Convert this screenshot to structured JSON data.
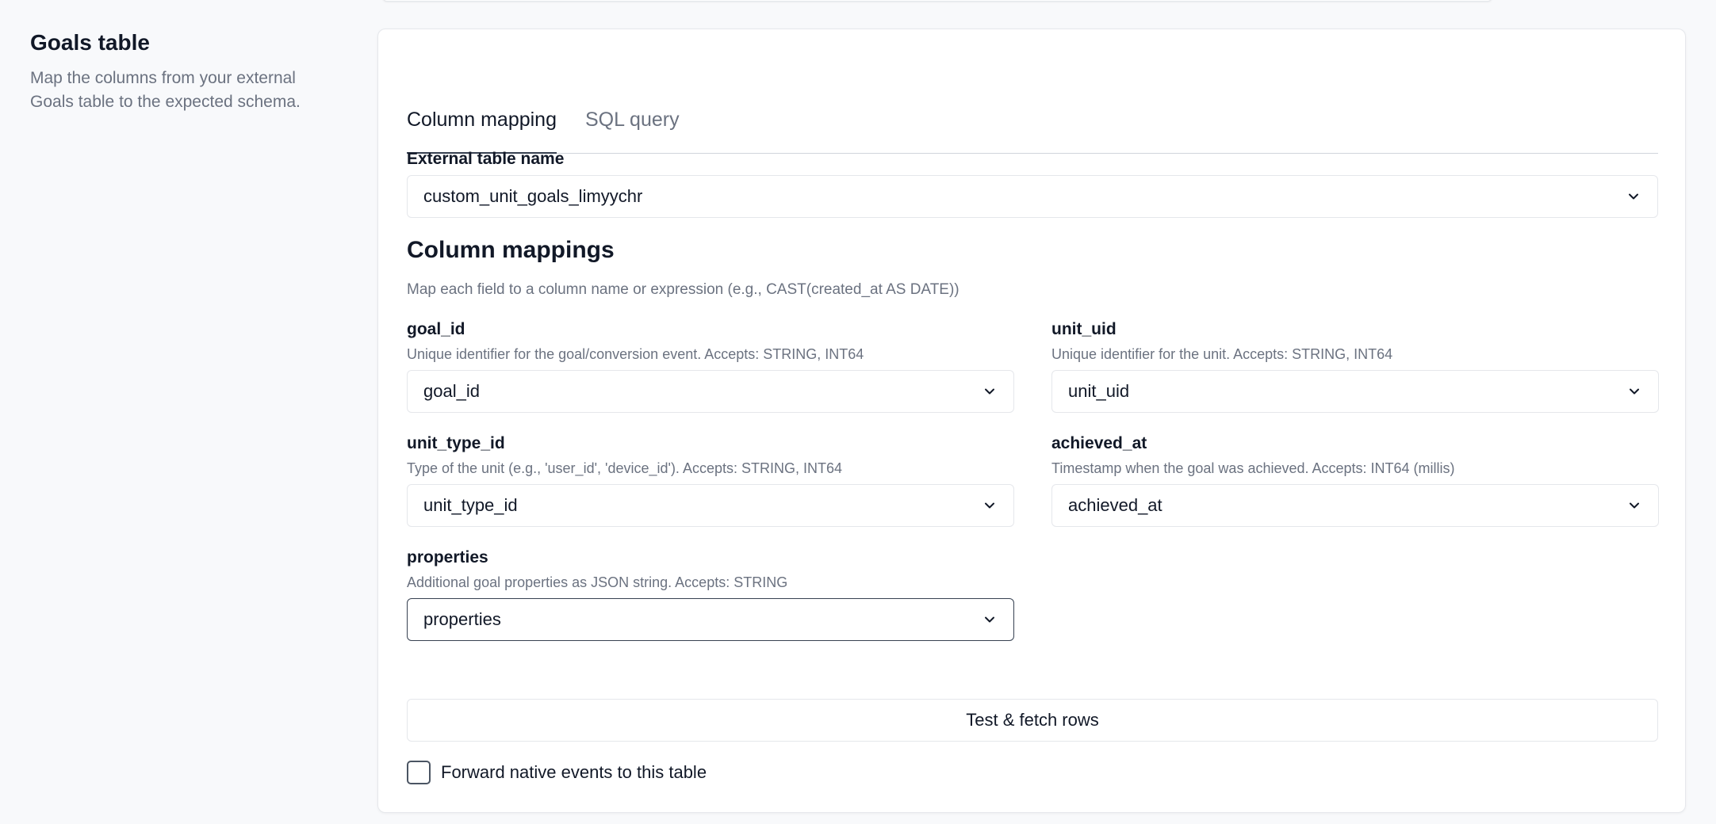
{
  "section": {
    "title": "Goals table",
    "description": "Map the columns from your external Goals table to the expected schema."
  },
  "tabs": [
    {
      "label": "Column mapping",
      "active": true
    },
    {
      "label": "SQL query",
      "active": false
    }
  ],
  "external_table": {
    "label": "External table name",
    "value": "custom_unit_goals_limyychr"
  },
  "mappings": {
    "title": "Column mappings",
    "subtitle": "Map each field to a column name or expression (e.g., CAST(created_at AS DATE))",
    "fields": [
      {
        "name": "goal_id",
        "hint": "Unique identifier for the goal/conversion event. Accepts: STRING, INT64",
        "value": "goal_id"
      },
      {
        "name": "unit_uid",
        "hint": "Unique identifier for the unit. Accepts: STRING, INT64",
        "value": "unit_uid"
      },
      {
        "name": "unit_type_id",
        "hint": "Type of the unit (e.g., 'user_id', 'device_id'). Accepts: STRING, INT64",
        "value": "unit_type_id"
      },
      {
        "name": "achieved_at",
        "hint": "Timestamp when the goal was achieved. Accepts: INT64 (millis)",
        "value": "achieved_at"
      },
      {
        "name": "properties",
        "hint": "Additional goal properties as JSON string. Accepts: STRING",
        "value": "properties"
      }
    ]
  },
  "actions": {
    "test_label": "Test & fetch rows",
    "forward_label": "Forward native events to this table",
    "forward_checked": false
  },
  "icons": {
    "dropdown": "chevron-down-icon"
  }
}
